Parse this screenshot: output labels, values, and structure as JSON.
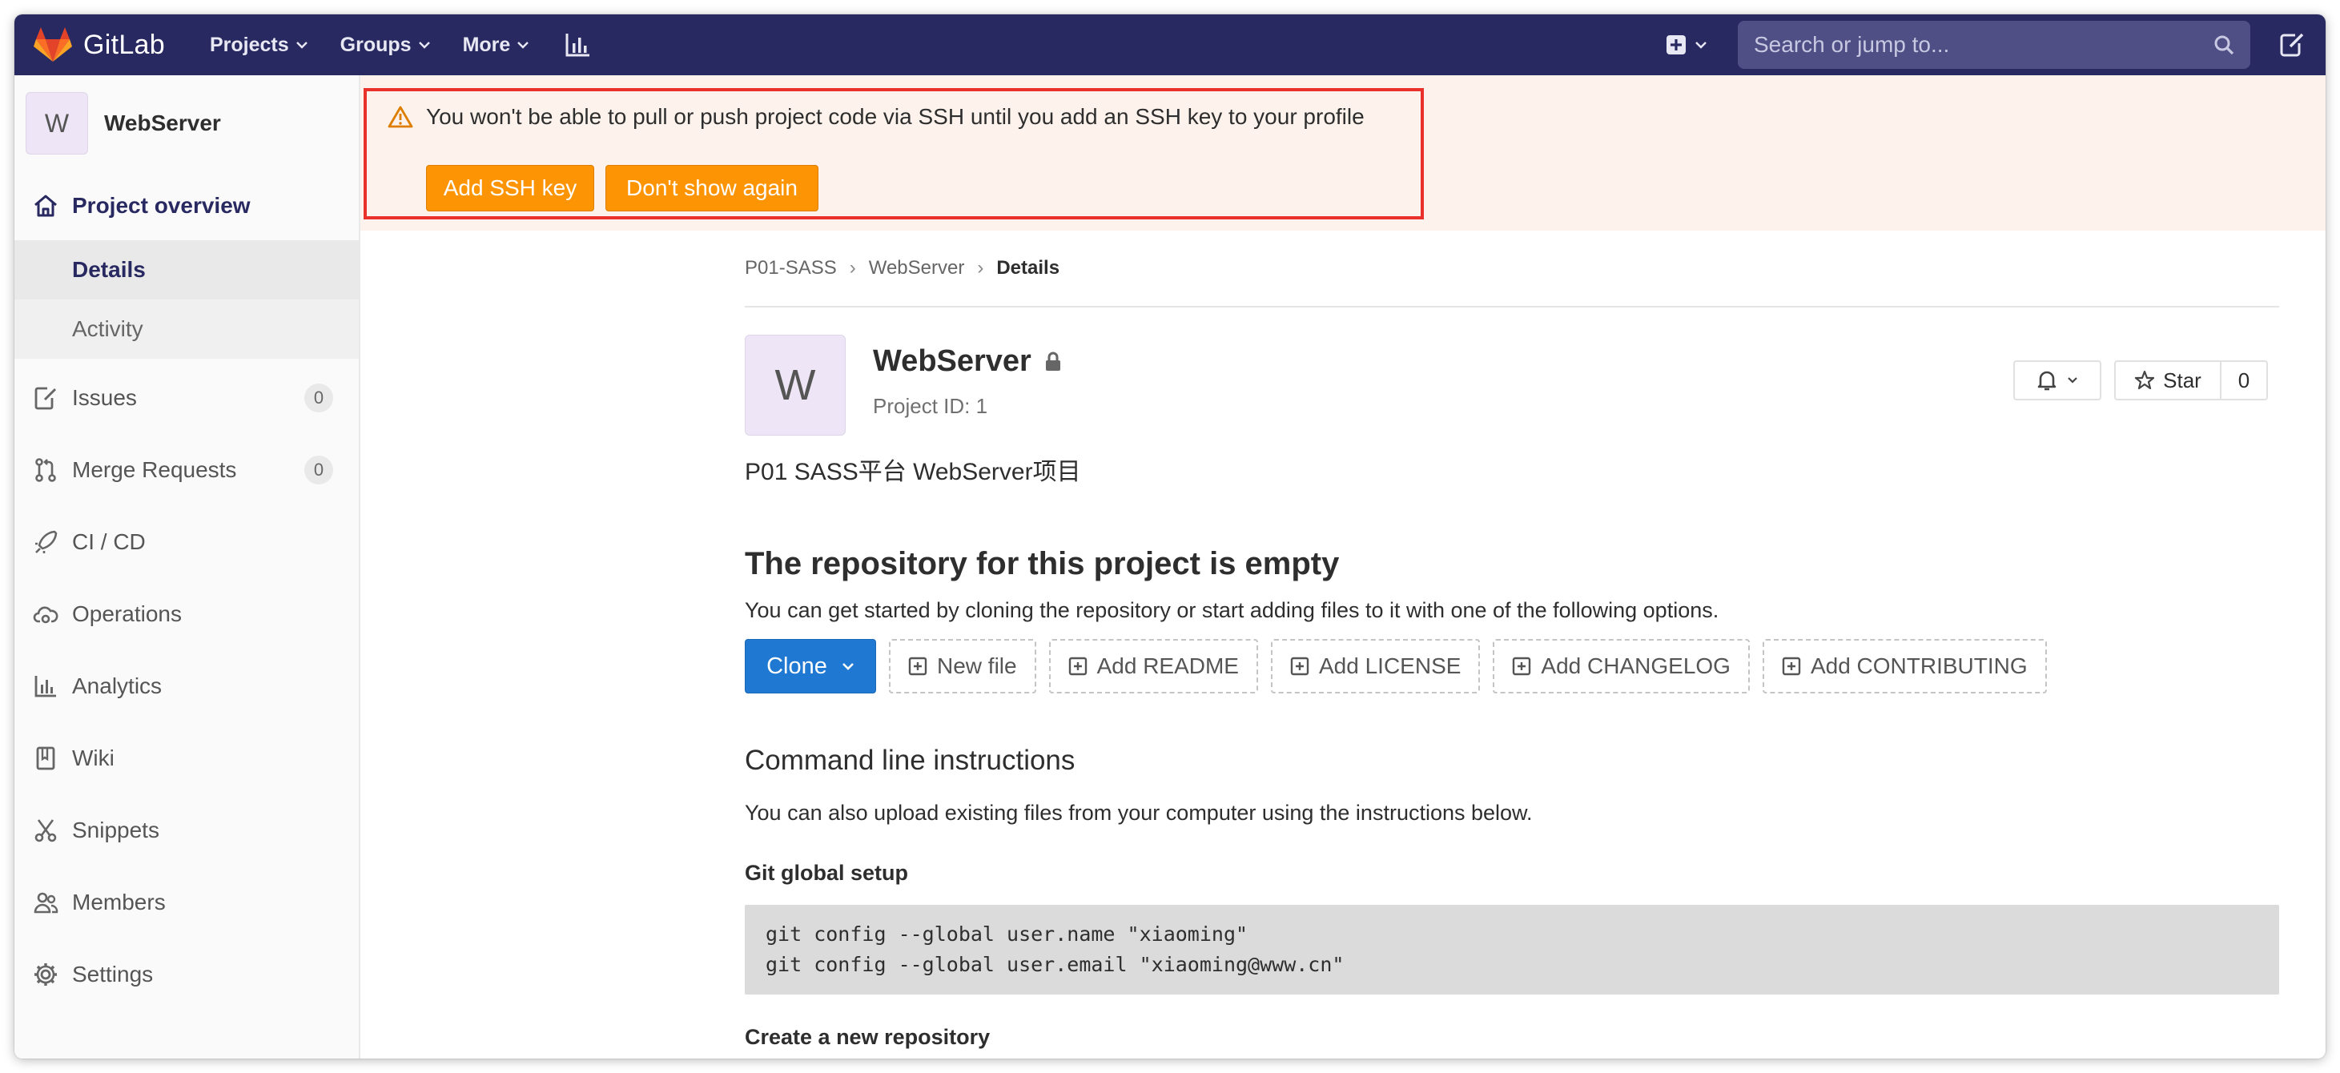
{
  "navbar": {
    "brand": "GitLab",
    "projects": "Projects",
    "groups": "Groups",
    "more": "More",
    "search_placeholder": "Search or jump to...",
    "bg_color": "#292961"
  },
  "sidebar": {
    "avatar_letter": "W",
    "project_name": "WebServer",
    "overview": "Project overview",
    "details": "Details",
    "activity": "Activity",
    "issues": "Issues",
    "issues_count": "0",
    "merge_requests": "Merge Requests",
    "mr_count": "0",
    "cicd": "CI / CD",
    "operations": "Operations",
    "analytics": "Analytics",
    "wiki": "Wiki",
    "snippets": "Snippets",
    "members": "Members",
    "settings": "Settings"
  },
  "alert": {
    "message": "You won't be able to pull or push project code via SSH until you add an SSH key to your profile",
    "add_ssh": "Add SSH key",
    "dont_show": "Don't show again",
    "highlight_color": "#e8312b"
  },
  "breadcrumb": [
    "P01-SASS",
    "WebServer",
    "Details"
  ],
  "project": {
    "avatar_letter": "W",
    "title": "WebServer",
    "id_label": "Project ID: 1",
    "description": "P01 SASS平台 WebServer项目",
    "star_label": "Star",
    "star_count": "0"
  },
  "empty": {
    "heading": "The repository for this project is empty",
    "text": "You can get started by cloning the repository or start adding files to it with one of the following options.",
    "clone": "Clone",
    "new_file": "New file",
    "add_readme": "Add README",
    "add_license": "Add LICENSE",
    "add_changelog": "Add CHANGELOG",
    "add_contributing": "Add CONTRIBUTING"
  },
  "cli": {
    "heading": "Command line instructions",
    "text": "You can also upload existing files from your computer using the instructions below.",
    "global_setup": "Git global setup",
    "line1": "git config --global user.name \"xiaoming\"",
    "line2": "git config --global user.email \"xiaoming@www.cn\"",
    "create_repo": "Create a new repository"
  }
}
